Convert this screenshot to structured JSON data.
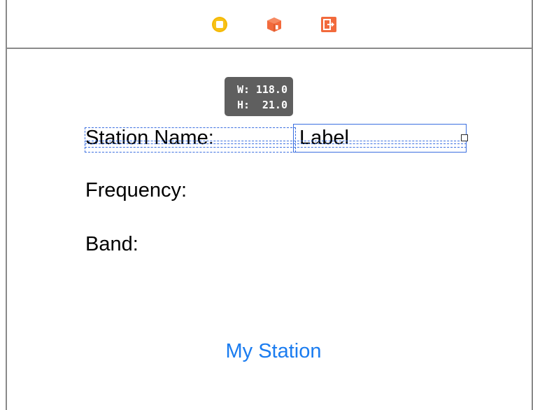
{
  "dock": {
    "icons": [
      {
        "name": "view-controller-icon",
        "color": "#f5b800"
      },
      {
        "name": "first-responder-icon",
        "color": "#f26a3c"
      },
      {
        "name": "exit-icon",
        "color": "#f26a3c"
      }
    ]
  },
  "size_tooltip": {
    "width_key": "W:",
    "width_value": "118.0",
    "height_key": "H:",
    "height_value": "21.0"
  },
  "labels": {
    "station_name": "Station Name:",
    "frequency": "Frequency:",
    "band": "Band:",
    "value_label": "Label"
  },
  "button": {
    "my_station": "My Station"
  },
  "colors": {
    "selection": "#3b6fe0",
    "button_text": "#1a7cf0",
    "tooltip_bg": "#5f5f5f"
  }
}
